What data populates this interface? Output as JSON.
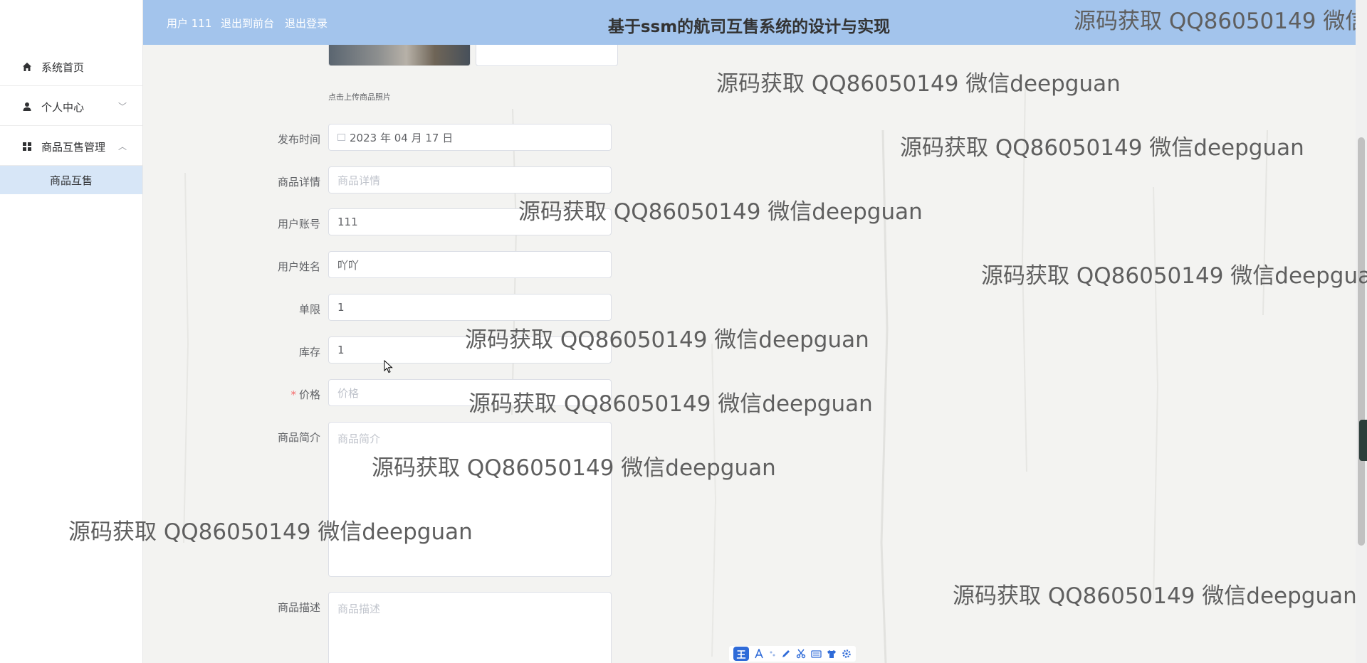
{
  "sidebar": {
    "items": [
      {
        "label": "系统首页",
        "icon": "home-icon"
      },
      {
        "label": "个人中心",
        "icon": "user-icon",
        "arrow": "﹀"
      },
      {
        "label": "商品互售管理",
        "icon": "grid-icon",
        "arrow": "︿"
      }
    ],
    "subitems": [
      {
        "label": "商品互售"
      }
    ]
  },
  "header": {
    "user_label": "用户 111",
    "front_link": "退出到前台",
    "logout_link": "退出登录",
    "title": "基于ssm的航司互售系统的设计与实现"
  },
  "form": {
    "upload_hint": "点击上传商品照片",
    "fields": {
      "publish_time": {
        "label": "发布时间",
        "value": "2023 年 04 月 17 日"
      },
      "detail": {
        "label": "商品详情",
        "placeholder": "商品详情"
      },
      "account": {
        "label": "用户账号",
        "value": "111"
      },
      "name": {
        "label": "用户姓名",
        "value": "吖吖"
      },
      "limit": {
        "label": "单限",
        "value": "1"
      },
      "stock": {
        "label": "库存",
        "value": "1"
      },
      "price": {
        "label": "价格",
        "required_mark": "*",
        "placeholder": "价格"
      },
      "intro": {
        "label": "商品简介",
        "placeholder": "商品简介"
      },
      "description": {
        "label": "商品描述",
        "placeholder": "商品描述"
      }
    }
  },
  "watermark": {
    "text": "源码获取 QQ86050149 微信deepguan",
    "cut_text": "源码获取 QQ86050149 微信d"
  },
  "ime_toolbar": {
    "badge": "王",
    "icons": [
      "font-icon",
      "dot-icon",
      "pen-icon",
      "scissors-icon",
      "keyboard-icon",
      "shirt-icon",
      "settings-icon"
    ]
  },
  "colors": {
    "header_bg": "#a3c4ec",
    "submenu_active_bg": "#d7e6f7",
    "required": "#f56c6c",
    "main_bg": "#f3f3f1"
  }
}
